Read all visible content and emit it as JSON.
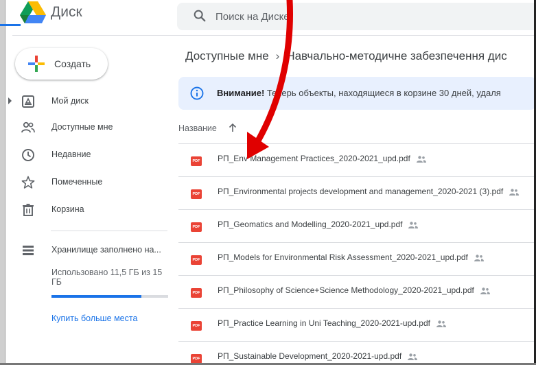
{
  "header": {
    "app_title": "Диск",
    "search_placeholder": "Поиск на Диске"
  },
  "sidebar": {
    "create_label": "Создать",
    "items": [
      {
        "label": "Мой диск",
        "icon": "drive-icon"
      },
      {
        "label": "Доступные мне",
        "icon": "shared-people-icon"
      },
      {
        "label": "Недавние",
        "icon": "clock-icon"
      },
      {
        "label": "Помеченные",
        "icon": "star-icon"
      },
      {
        "label": "Корзина",
        "icon": "trash-icon"
      }
    ],
    "storage": {
      "label": "Хранилище заполнено на...",
      "used_text": "Использовано 11,5 ГБ из 15 ГБ",
      "used_fraction": 0.77,
      "buy_more": "Купить больше места"
    }
  },
  "main": {
    "breadcrumb": {
      "root": "Доступные мне",
      "separator": "›",
      "current": "Навчально-методичне забезпечення дис"
    },
    "banner": {
      "bold": "Внимание!",
      "text": " Теперь объекты, находящиеся в корзине 30 дней, удаля"
    },
    "column_header": "Название",
    "files": [
      "РП_Env Management Practices_2020-2021_upd.pdf",
      "РП_Environmental projects development and management_2020-2021 (3).pdf",
      "РП_Geomatics and Modelling_2020-2021_upd.pdf",
      "РП_Models for Environmental Risk Assessment_2020-2021_upd.pdf",
      "РП_Philosophy of Science+Science Methodology_2020-2021_upd.pdf",
      "РП_Practice Learning in Uni Teaching_2020-2021-upd.pdf",
      "РП_Sustainable Development_2020-2021-upd.pdf"
    ],
    "pdf_badge": "PDF"
  },
  "colors": {
    "accent": "#1a73e8",
    "pdf_red": "#ea4335",
    "banner_bg": "#e8f0fe",
    "annotation_arrow": "#e00000"
  }
}
